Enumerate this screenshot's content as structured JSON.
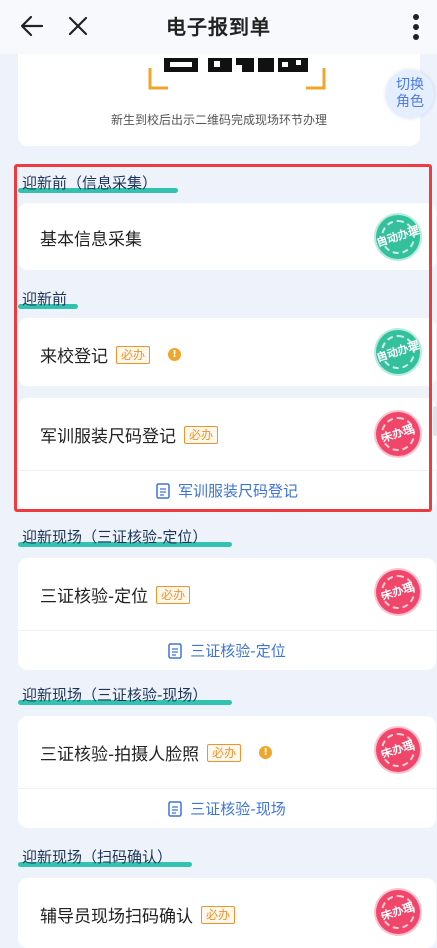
{
  "header": {
    "title": "电子报到单"
  },
  "qr": {
    "caption": "新生到校后出示二维码完成现场环节办理",
    "switch_role": "切换角色"
  },
  "sections": {
    "s1": {
      "title": "迎新前（信息采集）"
    },
    "s2": {
      "title": "迎新前"
    },
    "s3": {
      "title": "迎新现场（三证核验-定位）"
    },
    "s4": {
      "title": "迎新现场（三证核验-现场）"
    },
    "s5": {
      "title": "迎新现场（扫码确认）"
    }
  },
  "items": {
    "basic_info": {
      "label": "基本信息采集",
      "status": "自动办理"
    },
    "arrival": {
      "label": "来校登记",
      "badge": "必办",
      "status": "自动办理"
    },
    "uniform": {
      "label": "军训服装尺码登记",
      "badge": "必办",
      "status": "未办理",
      "link": "军训服装尺码登记"
    },
    "locate": {
      "label": "三证核验-定位",
      "badge": "必办",
      "status": "未办理",
      "link": "三证核验-定位"
    },
    "photo": {
      "label": "三证核验-拍摄人脸照",
      "badge": "必办",
      "status": "未办理",
      "link": "三证核验-现场"
    },
    "scan": {
      "label": "辅导员现场扫码确认",
      "badge": "必办",
      "status": "未办理"
    }
  },
  "colors": {
    "accent": "#3d74db",
    "required": "#f0932b",
    "auto": "#35c09d",
    "pending": "#f0466a",
    "highlight": "#ee3b3f"
  }
}
